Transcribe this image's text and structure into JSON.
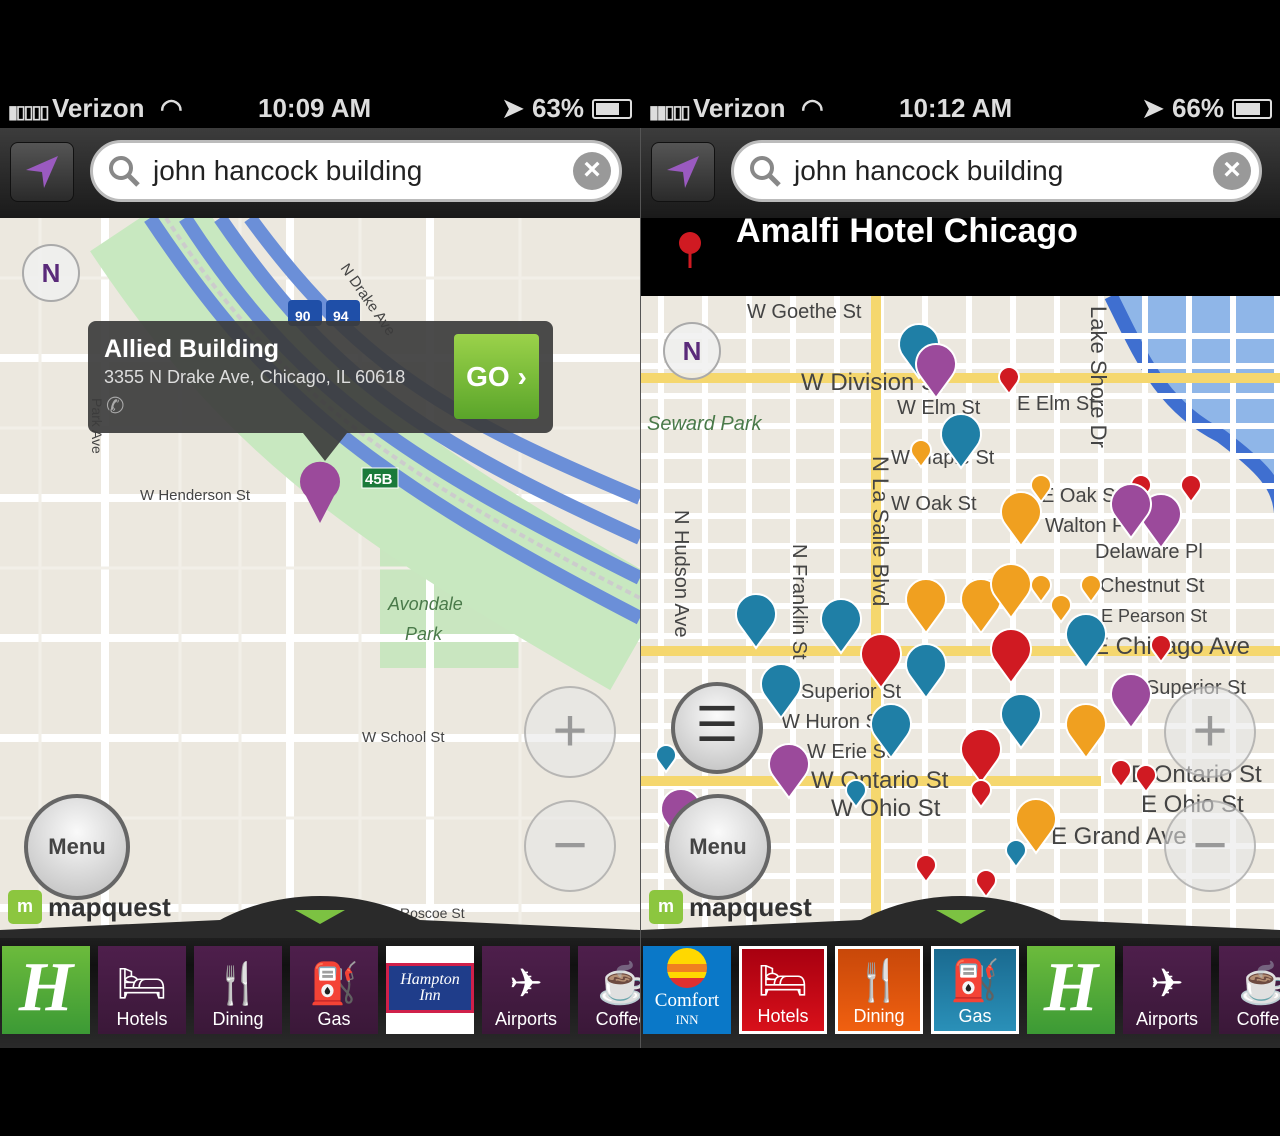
{
  "left": {
    "status": {
      "carrier": "Verizon",
      "time": "10:09 AM",
      "battery": "63%",
      "battery_level": 0.63
    },
    "search": {
      "query": "john hancock building"
    },
    "callout": {
      "title": "Allied Building",
      "address": "3355 N Drake Ave, Chicago, IL 60618",
      "go": "GO"
    },
    "map_labels": {
      "drake": "N Drake Ave",
      "henderson": "W Henderson St",
      "park": "Avondale",
      "park2": "Park",
      "school": "W School St",
      "parkave": "Park Ave",
      "shield1": "90",
      "shield2": "94",
      "exit": "45B",
      "roscoe": "Roscoe St"
    },
    "menu": "Menu",
    "brand": "mapquest",
    "compass": "N",
    "tiles": [
      {
        "label": ""
      },
      {
        "label": "Hotels"
      },
      {
        "label": "Dining"
      },
      {
        "label": "Gas"
      },
      {
        "label": "Hampton Inn"
      },
      {
        "label": "Airports"
      },
      {
        "label": "Coffee"
      }
    ]
  },
  "right": {
    "status": {
      "carrier": "Verizon",
      "time": "10:12 AM",
      "battery": "66%",
      "battery_level": 0.66
    },
    "search": {
      "query": "john hancock building"
    },
    "result_title": "Amalfi Hotel Chicago",
    "map_labels": {
      "goethe": "W Goethe St",
      "division": "W Division St",
      "elm": "W Elm St",
      "eelm": "E Elm St",
      "seward": "Seward Park",
      "maple": "W Maple St",
      "oak": "W Oak St",
      "eoak": "E Oak St",
      "walton": "Walton Pl",
      "delaware": "Delaware Pl",
      "chestnut": "E Chestnut St",
      "pearson": "E Pearson St",
      "lake": "Lake Shore Dr",
      "chicago": "E Chicago Ave",
      "superior": "E Superior St",
      "huron": "W Huron St",
      "erie": "W Erie St",
      "ontario": "W Ontario St",
      "ohio": "W Ohio St",
      "grand": "E Grand Ave",
      "hudson": "N Hudson Ave",
      "franklin": "N Franklin St",
      "lasalle": "N La Salle Blvd",
      "superior_w": "Superior St",
      "eontario": "E Ontario St",
      "eohio": "E Ohio St"
    },
    "menu": "Menu",
    "brand": "mapquest",
    "compass": "N",
    "tiles": [
      {
        "label": "Comfort",
        "sub": "INN"
      },
      {
        "label": "Hotels"
      },
      {
        "label": "Dining"
      },
      {
        "label": "Gas"
      },
      {
        "label": ""
      },
      {
        "label": "Airports"
      },
      {
        "label": "Coffee"
      }
    ],
    "selected_tiles": [
      "Hotels",
      "Dining",
      "Gas"
    ]
  },
  "colors": {
    "hotels": "#c8101a",
    "dining": "#e8620a",
    "gas": "#1f7fa6",
    "purple_tile": "#4e1f4c",
    "go": "#7cc242",
    "pin_purple": "#9b4a9b"
  }
}
